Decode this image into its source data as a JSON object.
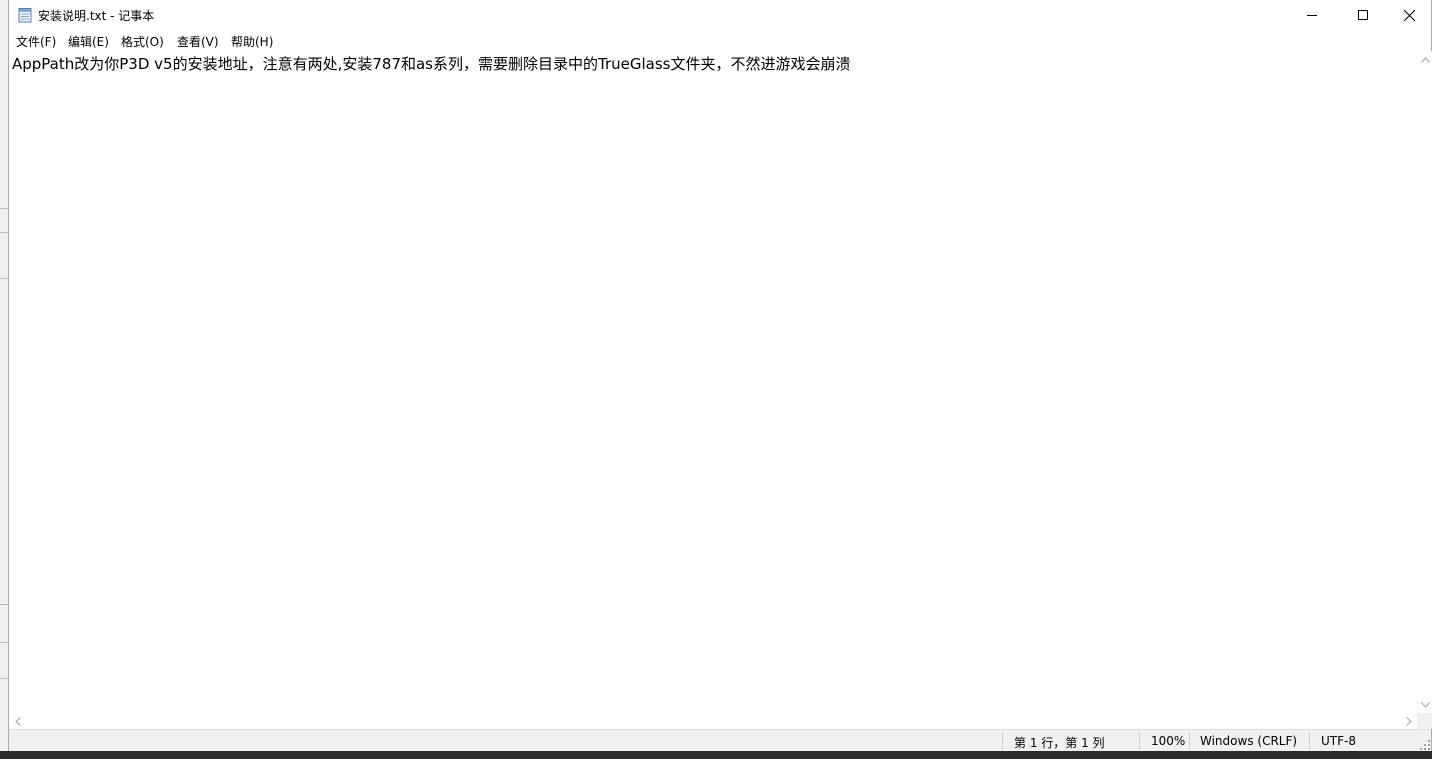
{
  "window": {
    "title": "安装说明.txt - 记事本",
    "controls": {
      "minimize_icon": "minimize-icon",
      "maximize_icon": "maximize-icon",
      "close_icon": "close-icon"
    }
  },
  "menu": {
    "items": [
      "文件(F)",
      "编辑(E)",
      "格式(O)",
      "查看(V)",
      "帮助(H)"
    ]
  },
  "editor": {
    "content": "AppPath改为你P3D v5的安装地址，注意有两处,安装787和as系列，需要删除目录中的TrueGlass文件夹，不然进游戏会崩溃"
  },
  "statusbar": {
    "position": "第 1 行，第 1 列",
    "zoom": "100%",
    "line_ending": "Windows (CRLF)",
    "encoding": "UTF-8"
  }
}
